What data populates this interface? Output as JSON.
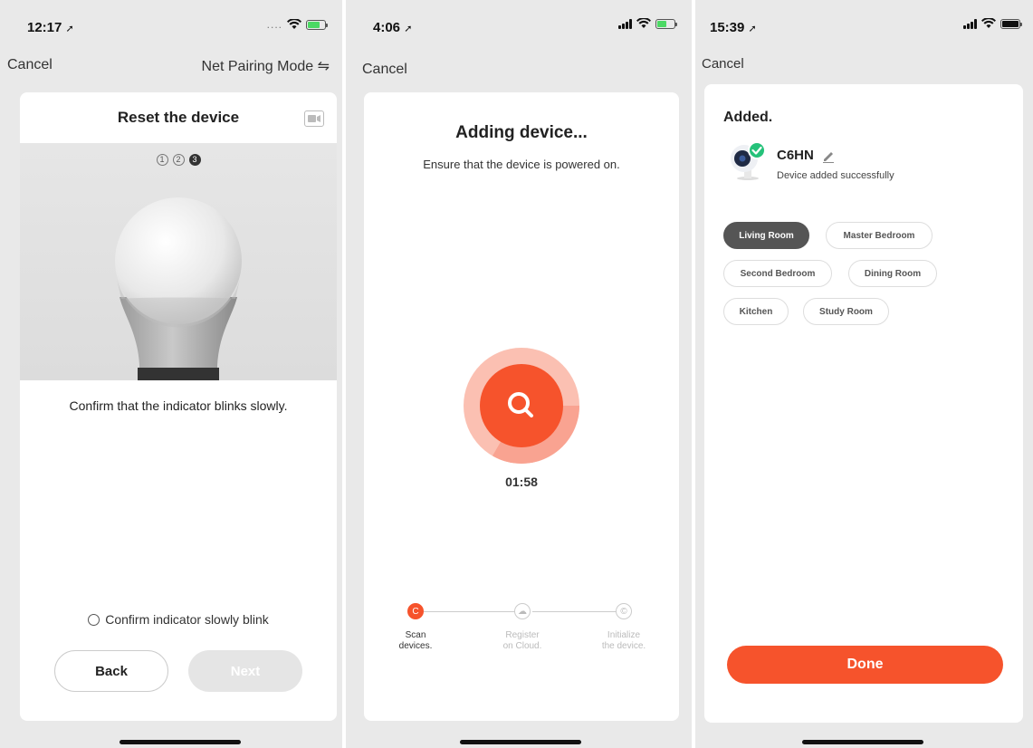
{
  "screen1": {
    "status": {
      "time": "12:17"
    },
    "nav": {
      "cancel": "Cancel",
      "mode": "Net Pairing Mode ⇋"
    },
    "card": {
      "title": "Reset the device",
      "steps": [
        "1",
        "2",
        "3"
      ],
      "active_step": 3,
      "message": "Confirm that the indicator blinks slowly.",
      "confirm_label": "Confirm indicator slowly blink",
      "back_label": "Back",
      "next_label": "Next"
    }
  },
  "screen2": {
    "status": {
      "time": "4:06"
    },
    "nav": {
      "cancel": "Cancel"
    },
    "card": {
      "title": "Adding device...",
      "subtitle": "Ensure that the device is powered on.",
      "timer": "01:58",
      "progress_steps": [
        {
          "line1": "Scan",
          "line2": "devices.",
          "icon": "C",
          "active": true
        },
        {
          "line1": "Register",
          "line2": "on Cloud.",
          "icon": "☁",
          "active": false
        },
        {
          "line1": "Initialize",
          "line2": "the device.",
          "icon": "©",
          "active": false
        }
      ]
    }
  },
  "screen3": {
    "status": {
      "time": "15:39"
    },
    "nav": {
      "cancel": "Cancel"
    },
    "card": {
      "title": "Added.",
      "device_name": "C6HN",
      "device_status": "Device added successfully",
      "rooms": [
        {
          "label": "Living Room",
          "selected": true
        },
        {
          "label": "Master Bedroom",
          "selected": false
        },
        {
          "label": "Second Bedroom",
          "selected": false
        },
        {
          "label": "Dining Room",
          "selected": false
        },
        {
          "label": "Kitchen",
          "selected": false
        },
        {
          "label": "Study Room",
          "selected": false
        }
      ],
      "done_label": "Done"
    }
  },
  "colors": {
    "accent": "#f6532c",
    "accent_light": "#f9a391",
    "selected_chip": "#555555",
    "background": "#e9e9e9"
  },
  "icons": [
    "location-arrow-icon",
    "wifi-icon",
    "battery-icon",
    "signal-icon",
    "video-icon",
    "search-icon",
    "edit-pencil-icon",
    "check-badge-icon",
    "camera-device-icon"
  ]
}
